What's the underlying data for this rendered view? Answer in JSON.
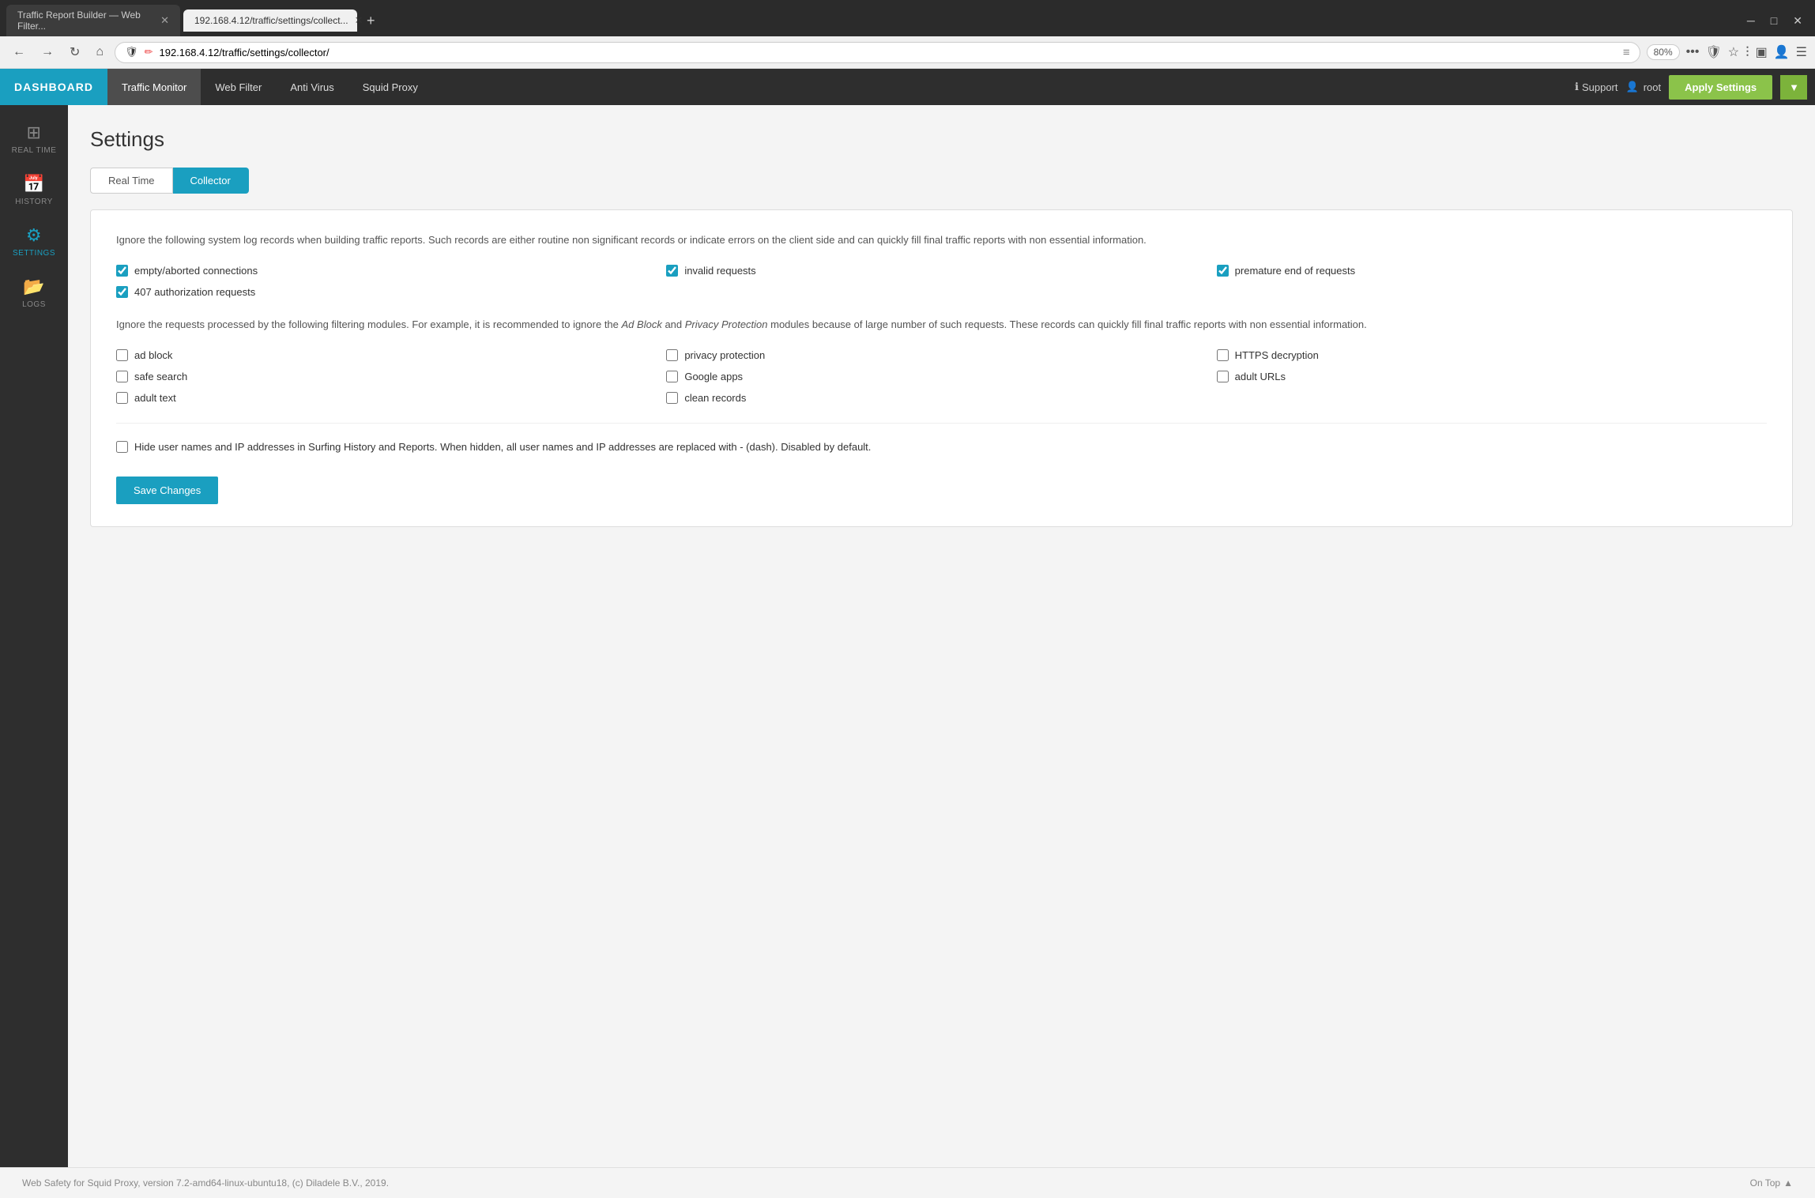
{
  "browser": {
    "tabs": [
      {
        "id": "tab1",
        "title": "Traffic Report Builder — Web Filter...",
        "active": false
      },
      {
        "id": "tab2",
        "title": "192.168.4.12/traffic/settings/collect...",
        "active": true
      }
    ],
    "address": "192.168.4.12/traffic/settings/collector/",
    "zoom": "80%",
    "shield_icon": "🛡",
    "edit_icon": "✏"
  },
  "header": {
    "logo": "DASHBOARD",
    "nav_items": [
      {
        "label": "Traffic Monitor",
        "active": true
      },
      {
        "label": "Web Filter",
        "active": false
      },
      {
        "label": "Anti Virus",
        "active": false
      },
      {
        "label": "Squid Proxy",
        "active": false
      }
    ],
    "support_label": "Support",
    "user_label": "root",
    "apply_btn_label": "Apply Settings"
  },
  "sidebar": {
    "items": [
      {
        "id": "realtime",
        "label": "REAL TIME",
        "icon": "⊞",
        "active": false
      },
      {
        "id": "history",
        "label": "HISTORY",
        "icon": "📅",
        "active": false
      },
      {
        "id": "settings",
        "label": "SETTINGS",
        "icon": "⚙",
        "active": true
      },
      {
        "id": "logs",
        "label": "LOGS",
        "icon": "📂",
        "active": false
      }
    ]
  },
  "page": {
    "title": "Settings",
    "tabs": [
      {
        "label": "Real Time",
        "active": false
      },
      {
        "label": "Collector",
        "active": true
      }
    ],
    "description1": "Ignore the following system log records when building traffic reports. Such records are either routine non significant records or indicate errors on the client side and can quickly fill final traffic reports with non essential information.",
    "checkboxes_group1": [
      {
        "label": "empty/aborted connections",
        "checked": true
      },
      {
        "label": "invalid requests",
        "checked": true
      },
      {
        "label": "premature end of requests",
        "checked": true
      },
      {
        "label": "407 authorization requests",
        "checked": true
      }
    ],
    "description2_prefix": "Ignore the requests processed by the following filtering modules. For example, it is recommended to ignore the ",
    "description2_em1": "Ad Block",
    "description2_mid": " and ",
    "description2_em2": "Privacy Protection",
    "description2_suffix": " modules because of large number of such requests. These records can quickly fill final traffic reports with non essential information.",
    "checkboxes_group2": [
      {
        "label": "ad block",
        "checked": false
      },
      {
        "label": "privacy protection",
        "checked": false
      },
      {
        "label": "HTTPS decryption",
        "checked": false
      },
      {
        "label": "safe search",
        "checked": false
      },
      {
        "label": "Google apps",
        "checked": false
      },
      {
        "label": "adult URLs",
        "checked": false
      },
      {
        "label": "adult text",
        "checked": false
      },
      {
        "label": "clean records",
        "checked": false
      }
    ],
    "hide_label": "Hide user names and IP addresses in Surfing History and Reports. When hidden, all user names and IP addresses are replaced with - (dash). Disabled by default.",
    "hide_checked": false,
    "save_btn_label": "Save Changes"
  },
  "footer": {
    "text": "Web Safety for Squid Proxy, version 7.2-amd64-linux-ubuntu18, (c) Diladele B.V., 2019.",
    "on_top_label": "On Top"
  }
}
